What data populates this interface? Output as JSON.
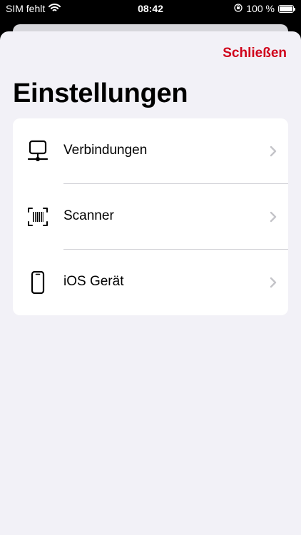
{
  "status_bar": {
    "carrier": "SIM fehlt",
    "time": "08:42",
    "battery": "100 %",
    "battery_level": 1.0,
    "icons": [
      "wifi-icon",
      "orientation-lock-icon",
      "battery-icon"
    ]
  },
  "header": {
    "close_label": "Schließen",
    "title": "Einstellungen"
  },
  "settings": {
    "items": [
      {
        "label": "Verbindungen",
        "icon": "network-computer-icon"
      },
      {
        "label": "Scanner",
        "icon": "barcode-scan-icon"
      },
      {
        "label": "iOS Gerät",
        "icon": "iphone-icon"
      }
    ]
  },
  "colors": {
    "accent": "#d0021b",
    "background": "#f2f1f7",
    "card": "#ffffff",
    "chevron": "#c4c4c9"
  }
}
